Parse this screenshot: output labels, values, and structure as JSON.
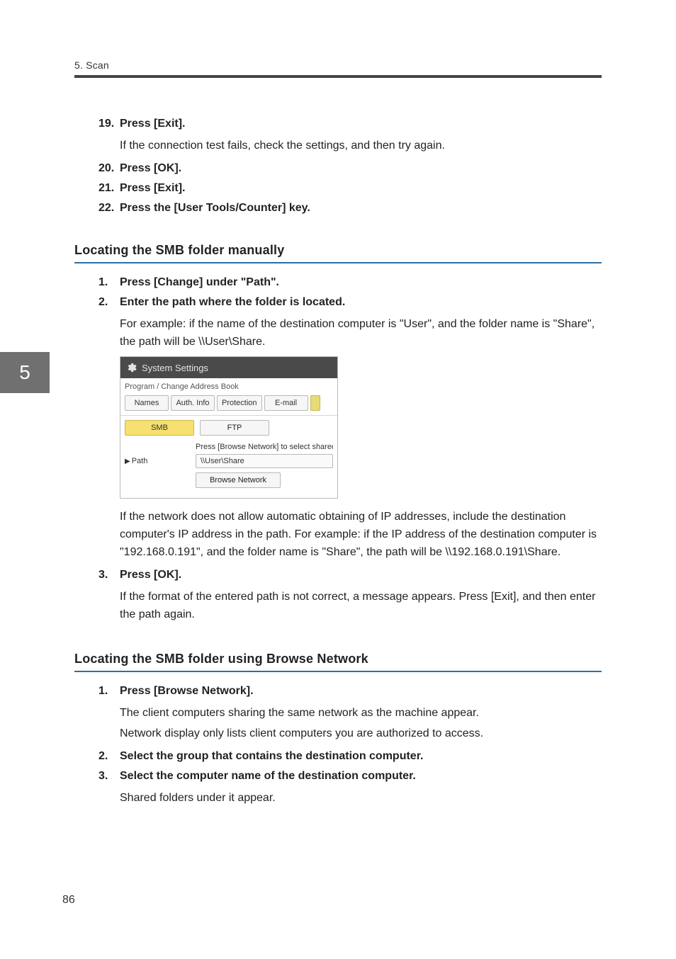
{
  "header": {
    "chapter_label": "5. Scan"
  },
  "chapter_tab": "5",
  "page_number": "86",
  "sectionA": {
    "steps": [
      {
        "num": "19.",
        "text": "Press [Exit].",
        "body": "If the connection test fails, check the settings, and then try again."
      },
      {
        "num": "20.",
        "text": "Press [OK]."
      },
      {
        "num": "21.",
        "text": "Press [Exit]."
      },
      {
        "num": "22.",
        "text": "Press the [User Tools/Counter] key."
      }
    ]
  },
  "sectionB": {
    "title": "Locating the SMB folder manually",
    "steps": [
      {
        "num": "1.",
        "text": "Press [Change] under \"Path\"."
      },
      {
        "num": "2.",
        "text": "Enter the path where the folder is located.",
        "body": "For example: if the name of the destination computer is \"User\", and the folder name is \"Share\", the path will be \\\\User\\Share.",
        "body2": "If the network does not allow automatic obtaining of IP addresses, include the destination computer's IP address in the path. For example: if the IP address of the destination computer is \"192.168.0.191\", and the folder name is \"Share\", the path will be \\\\192.168.0.191\\Share."
      },
      {
        "num": "3.",
        "text": "Press [OK].",
        "body": "If the format of the entered path is not correct, a message appears. Press [Exit], and then enter the path again."
      }
    ]
  },
  "sectionC": {
    "title": "Locating the SMB folder using Browse Network",
    "steps": [
      {
        "num": "1.",
        "text": "Press [Browse Network].",
        "body": "The client computers sharing the same network as the machine appear.",
        "body2": "Network display only lists client computers you are authorized to access."
      },
      {
        "num": "2.",
        "text": "Select the group that contains the destination computer."
      },
      {
        "num": "3.",
        "text": "Select the computer name of the destination computer.",
        "body": "Shared folders under it appear."
      }
    ]
  },
  "ui": {
    "title": "System Settings",
    "subhead": "Program / Change Address Book",
    "tabs": {
      "names": "Names",
      "auth": "Auth. Info",
      "protection": "Protection",
      "email": "E-mail"
    },
    "protocols": {
      "smb": "SMB",
      "ftp": "FTP"
    },
    "instruction": "Press [Browse Network] to select shared f",
    "path_label": "Path",
    "path_value": "\\\\User\\Share",
    "browse_label": "Browse Network"
  }
}
